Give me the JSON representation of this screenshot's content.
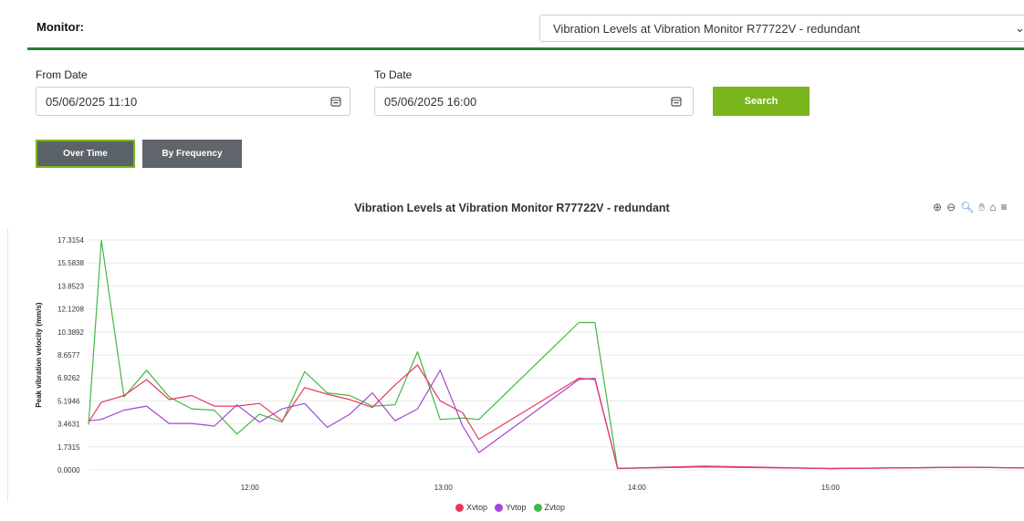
{
  "monitor": {
    "label": "Monitor:",
    "selected": "Vibration Levels at Vibration Monitor R77722V - redundant"
  },
  "filters": {
    "from_label": "From Date",
    "from_value": "05/06/2025 11:10",
    "to_label": "To Date",
    "to_value": "05/06/2025 16:00",
    "search_label": "Search"
  },
  "view_tabs": [
    {
      "label": "Over Time",
      "active": true
    },
    {
      "label": "By Frequency",
      "active": false
    }
  ],
  "toolbar_icons": [
    "zoom-in-icon",
    "zoom-out-icon",
    "zoom-selection-icon",
    "pan-hand-icon",
    "home-icon",
    "menu-icon"
  ],
  "colors": {
    "accent_green": "#7ab51d",
    "rule_green": "#2e7d32",
    "x": "#e8365e",
    "y": "#a347d6",
    "z": "#42b842"
  },
  "chart_data": {
    "type": "line",
    "title": "Vibration Levels at Vibration Monitor R77722V - redundant",
    "ylabel": "Peak vibration velocity (mm/s)",
    "xlabel": "",
    "yticks": [
      "17.3154",
      "15.5838",
      "13.8523",
      "12.1208",
      "10.3892",
      "8.6577",
      "6.9262",
      "5.1946",
      "3.4631",
      "1.7315",
      "0.0000"
    ],
    "ylim": [
      0,
      17.3154
    ],
    "xticks": [
      "12:00",
      "13:00",
      "14:00",
      "15:00"
    ],
    "xlim": [
      "11:10",
      "16:00"
    ],
    "grid": true,
    "legend_position": "bottom",
    "series": [
      {
        "name": "Xvtop",
        "color": "#e8365e",
        "points": [
          [
            "11:10",
            3.6
          ],
          [
            "11:14",
            5.1
          ],
          [
            "11:21",
            5.6
          ],
          [
            "11:28",
            6.8
          ],
          [
            "11:35",
            5.3
          ],
          [
            "11:42",
            5.6
          ],
          [
            "11:49",
            4.8
          ],
          [
            "11:56",
            4.8
          ],
          [
            "12:03",
            5.0
          ],
          [
            "12:10",
            3.7
          ],
          [
            "12:17",
            6.2
          ],
          [
            "12:24",
            5.7
          ],
          [
            "12:31",
            5.3
          ],
          [
            "12:38",
            4.7
          ],
          [
            "12:45",
            6.4
          ],
          [
            "12:52",
            7.9
          ],
          [
            "12:59",
            5.2
          ],
          [
            "13:06",
            4.3
          ],
          [
            "13:11",
            2.3
          ],
          [
            "13:42",
            6.9
          ],
          [
            "13:47",
            6.8
          ],
          [
            "13:54",
            0.12
          ],
          [
            "14:21",
            0.28
          ],
          [
            "15:00",
            0.1
          ],
          [
            "15:43",
            0.2
          ],
          [
            "16:00",
            0.15
          ]
        ]
      },
      {
        "name": "Yvtop",
        "color": "#a347d6",
        "points": [
          [
            "11:10",
            3.7
          ],
          [
            "11:14",
            3.8
          ],
          [
            "11:21",
            4.5
          ],
          [
            "11:28",
            4.8
          ],
          [
            "11:35",
            3.5
          ],
          [
            "11:42",
            3.5
          ],
          [
            "11:49",
            3.3
          ],
          [
            "11:56",
            4.9
          ],
          [
            "12:03",
            3.6
          ],
          [
            "12:10",
            4.6
          ],
          [
            "12:17",
            5.0
          ],
          [
            "12:24",
            3.2
          ],
          [
            "12:31",
            4.2
          ],
          [
            "12:38",
            5.8
          ],
          [
            "12:45",
            3.7
          ],
          [
            "12:52",
            4.6
          ],
          [
            "12:59",
            7.5
          ],
          [
            "13:06",
            3.3
          ],
          [
            "13:11",
            1.3
          ],
          [
            "13:42",
            6.8
          ],
          [
            "13:47",
            6.9
          ],
          [
            "13:54",
            0.12
          ],
          [
            "14:21",
            0.22
          ],
          [
            "15:00",
            0.1
          ],
          [
            "15:43",
            0.2
          ],
          [
            "16:00",
            0.15
          ]
        ]
      },
      {
        "name": "Zvtop",
        "color": "#42b842",
        "points": [
          [
            "11:10",
            3.4
          ],
          [
            "11:14",
            17.3
          ],
          [
            "11:21",
            5.5
          ],
          [
            "11:28",
            7.5
          ],
          [
            "11:35",
            5.5
          ],
          [
            "11:42",
            4.6
          ],
          [
            "11:49",
            4.5
          ],
          [
            "11:56",
            2.7
          ],
          [
            "12:03",
            4.2
          ],
          [
            "12:10",
            3.6
          ],
          [
            "12:17",
            7.4
          ],
          [
            "12:24",
            5.8
          ],
          [
            "12:31",
            5.6
          ],
          [
            "12:38",
            4.8
          ],
          [
            "12:45",
            4.9
          ],
          [
            "12:52",
            8.9
          ],
          [
            "12:59",
            3.8
          ],
          [
            "13:06",
            3.9
          ],
          [
            "13:11",
            3.8
          ],
          [
            "13:42",
            11.1
          ],
          [
            "13:47",
            11.1
          ],
          [
            "13:54",
            0.1
          ],
          [
            "14:21",
            0.25
          ],
          [
            "15:00",
            0.1
          ],
          [
            "15:43",
            0.2
          ],
          [
            "16:00",
            0.15
          ]
        ]
      }
    ]
  }
}
